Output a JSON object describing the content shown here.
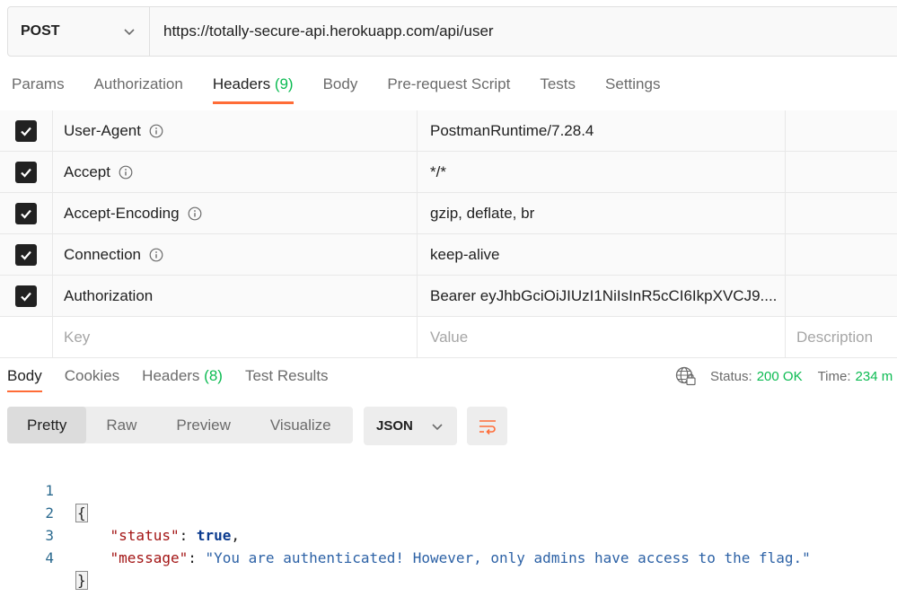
{
  "request": {
    "method": "POST",
    "url": "https://totally-secure-api.herokuapp.com/api/user"
  },
  "request_tabs": [
    {
      "label": "Params"
    },
    {
      "label": "Authorization"
    },
    {
      "label": "Headers",
      "count": "(9)"
    },
    {
      "label": "Body"
    },
    {
      "label": "Pre-request Script"
    },
    {
      "label": "Tests"
    },
    {
      "label": "Settings"
    }
  ],
  "headers": [
    {
      "key": "User-Agent",
      "value": "PostmanRuntime/7.28.4",
      "checked": true,
      "info_icon": true
    },
    {
      "key": "Accept",
      "value": "*/*",
      "checked": true,
      "info_icon": true
    },
    {
      "key": "Accept-Encoding",
      "value": "gzip, deflate, br",
      "checked": true,
      "info_icon": true
    },
    {
      "key": "Connection",
      "value": "keep-alive",
      "checked": true,
      "info_icon": true
    },
    {
      "key": "Authorization",
      "value": "Bearer eyJhbGciOiJIUzI1NiIsInR5cCI6IkpXVCJ9....",
      "checked": true,
      "info_icon": false
    }
  ],
  "new_header": {
    "key_placeholder": "Key",
    "value_placeholder": "Value",
    "description_placeholder": "Description"
  },
  "response_tabs": [
    {
      "label": "Body"
    },
    {
      "label": "Cookies"
    },
    {
      "label": "Headers",
      "count": "(8)"
    },
    {
      "label": "Test Results"
    }
  ],
  "response_status": {
    "status_label": "Status:",
    "status_value": "200 OK",
    "time_label": "Time:",
    "time_value": "234 m"
  },
  "view_modes": [
    {
      "label": "Pretty"
    },
    {
      "label": "Raw"
    },
    {
      "label": "Preview"
    },
    {
      "label": "Visualize"
    }
  ],
  "format": "JSON",
  "icons": {
    "method_dropdown": "chevron-down-icon",
    "header_info": "info-icon",
    "checkbox": "checkmark-icon",
    "network": "globe-lock-icon",
    "format_dropdown": "chevron-down-icon",
    "wrap": "wrap-lines-icon"
  },
  "colors": {
    "accent": "#ff6c37",
    "success": "#0cbb52"
  },
  "response_body": {
    "line_numbers": [
      "1",
      "2",
      "3",
      "4"
    ],
    "open_brace": "{",
    "close_brace": "}",
    "status_key": "\"status\"",
    "status_value": "true",
    "message_key": "\"message\"",
    "message_value": "\"You are authenticated! However, only admins have access to the flag.\""
  }
}
